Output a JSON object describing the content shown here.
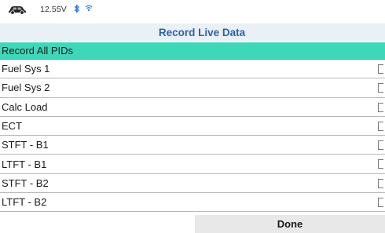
{
  "status_bar": {
    "vehicle_icon": "car-icon",
    "voltage": "12.55V",
    "bluetooth_icon": "bluetooth-icon",
    "wifi_icon": "wifi-icon"
  },
  "title": "Record Live Data",
  "header_row": {
    "label": "Record All PIDs"
  },
  "items": [
    {
      "label": "Fuel Sys 1",
      "checked": false
    },
    {
      "label": "Fuel Sys 2",
      "checked": false
    },
    {
      "label": "Calc Load",
      "checked": false
    },
    {
      "label": "ECT",
      "checked": false
    },
    {
      "label": "STFT - B1",
      "checked": false
    },
    {
      "label": "LTFT - B1",
      "checked": false
    },
    {
      "label": "STFT - B2",
      "checked": false
    },
    {
      "label": "LTFT - B2",
      "checked": false
    }
  ],
  "done_button": {
    "label": "Done"
  },
  "colors": {
    "header_row_bg": "#3ed7b9",
    "title_text": "#2b63a6",
    "title_bar_bg": "#e9f0f6",
    "icon_blue": "#2f7de1"
  }
}
